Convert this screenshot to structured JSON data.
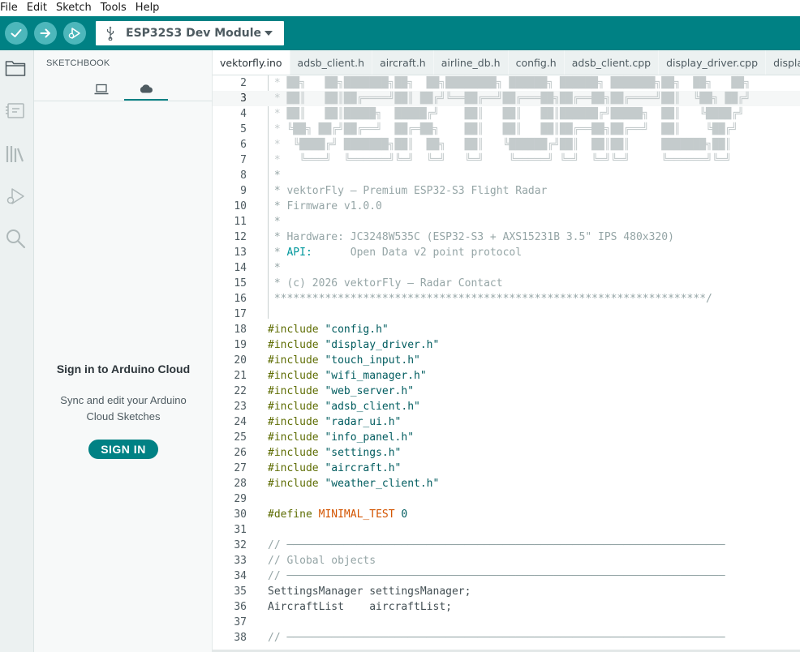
{
  "menubar": {
    "items": [
      "File",
      "Edit",
      "Sketch",
      "Tools",
      "Help"
    ]
  },
  "toolbar": {
    "board_name": "ESP32S3 Dev Module",
    "colors": {
      "bar": "#008184",
      "button": "#4db7bb"
    },
    "icons": [
      "verify-icon",
      "upload-icon",
      "debug-icon",
      "usb-icon",
      "chevron-down-icon"
    ]
  },
  "sidebar": {
    "icons": [
      "folder-icon",
      "board-manager-icon",
      "library-icon",
      "debug-icon",
      "search-icon"
    ]
  },
  "panel": {
    "title": "SKETCHBOOK",
    "tabs": [
      "local-sketches-icon",
      "cloud-icon"
    ],
    "signin_title": "Sign in to Arduino Cloud",
    "signin_desc": "Sync and edit your Arduino Cloud Sketches",
    "signin_button": "SIGN IN"
  },
  "tabs": [
    "vektorfly.ino",
    "adsb_client.h",
    "aircraft.h",
    "airline_db.h",
    "config.h",
    "adsb_client.cpp",
    "display_driver.cpp",
    "display_drive"
  ],
  "editor": {
    "current_line": 3,
    "lines": [
      {
        "n": "2",
        "kind": "art",
        "text": " * ██╗   ██╗███████╗██╗  ██╗████████╗ ██████╗ ██████╗ ███████╗██╗  ██╗   ██╗"
      },
      {
        "n": "3",
        "kind": "art",
        "text": " * ██║   ██║██╔════╝██║ ██╔╝╚══██╔══╝██╔═══██╗██╔══██╗██╔════╝██║  ╚██╗ ██╔╝"
      },
      {
        "n": "4",
        "kind": "art",
        "text": " * ██║   ██║█████╗  █████╔╝    ██║   ██║   ██║██████╔╝█████╗  ██║   ╚████╔╝"
      },
      {
        "n": "5",
        "kind": "art",
        "text": " * ╚██╗ ██╔╝██╔══╝  ██╔═██╗    ██║   ██║   ██║██╔══██╗██╔══╝  ██║    ╚██╔╝"
      },
      {
        "n": "6",
        "kind": "art",
        "text": " *  ╚████╔╝ ███████╗██║  ██╗   ██║   ╚██████╔╝██║  ██║██║     ███████╗██║"
      },
      {
        "n": "7",
        "kind": "art",
        "text": " *   ╚═══╝  ╚══════╝╚═╝  ╚═╝   ╚═╝    ╚═════╝ ╚═╝  ╚═╝╚═╝     ╚══════╝╚═╝"
      },
      {
        "n": "8",
        "kind": "comment",
        "text": " *"
      },
      {
        "n": "9",
        "kind": "comment",
        "text": " * vektorFly — Premium ESP32-S3 Flight Radar"
      },
      {
        "n": "10",
        "kind": "comment",
        "text": " * Firmware v1.0.0"
      },
      {
        "n": "11",
        "kind": "comment",
        "text": " *"
      },
      {
        "n": "12",
        "kind": "comment",
        "text": " * Hardware: JC3248W535C (ESP32-S3 + AXS15231B 3.5\" IPS 480x320)"
      },
      {
        "n": "13",
        "kind": "api",
        "prefix": " * ",
        "key": "API:",
        "text": "      Open Data v2 point protocol"
      },
      {
        "n": "14",
        "kind": "comment",
        "text": " *"
      },
      {
        "n": "15",
        "kind": "comment",
        "text": " * (c) 2026 vektorFly — Radar Contact"
      },
      {
        "n": "16",
        "kind": "comment",
        "text": " ********************************************************************/"
      },
      {
        "n": "17",
        "kind": "blank",
        "text": ""
      },
      {
        "n": "18",
        "kind": "include",
        "kw": "#include",
        "text": " \"config.h\""
      },
      {
        "n": "19",
        "kind": "include",
        "kw": "#include",
        "text": " \"display_driver.h\""
      },
      {
        "n": "20",
        "kind": "include",
        "kw": "#include",
        "text": " \"touch_input.h\""
      },
      {
        "n": "21",
        "kind": "include",
        "kw": "#include",
        "text": " \"wifi_manager.h\""
      },
      {
        "n": "22",
        "kind": "include",
        "kw": "#include",
        "text": " \"web_server.h\""
      },
      {
        "n": "23",
        "kind": "include",
        "kw": "#include",
        "text": " \"adsb_client.h\""
      },
      {
        "n": "24",
        "kind": "include",
        "kw": "#include",
        "text": " \"radar_ui.h\""
      },
      {
        "n": "25",
        "kind": "include",
        "kw": "#include",
        "text": " \"info_panel.h\""
      },
      {
        "n": "26",
        "kind": "include",
        "kw": "#include",
        "text": " \"settings.h\""
      },
      {
        "n": "27",
        "kind": "include",
        "kw": "#include",
        "text": " \"aircraft.h\""
      },
      {
        "n": "28",
        "kind": "include",
        "kw": "#include",
        "text": " \"weather_client.h\""
      },
      {
        "n": "29",
        "kind": "blank",
        "text": ""
      },
      {
        "n": "30",
        "kind": "define",
        "kw": "#define",
        "name": " MINIMAL_TEST",
        "text": " 0"
      },
      {
        "n": "31",
        "kind": "blank",
        "text": ""
      },
      {
        "n": "32",
        "kind": "comment",
        "text": "// ─────────────────────────────────────────────────────────────────────"
      },
      {
        "n": "33",
        "kind": "comment",
        "text": "// Global objects"
      },
      {
        "n": "34",
        "kind": "comment",
        "text": "// ─────────────────────────────────────────────────────────────────────"
      },
      {
        "n": "35",
        "kind": "plain",
        "text": "SettingsManager settingsManager;"
      },
      {
        "n": "36",
        "kind": "plain",
        "text": "AircraftList    aircraftList;"
      },
      {
        "n": "37",
        "kind": "blank",
        "text": ""
      },
      {
        "n": "38",
        "kind": "comment",
        "text": "// ─────────────────────────────────────────────────────────────────────"
      }
    ]
  }
}
